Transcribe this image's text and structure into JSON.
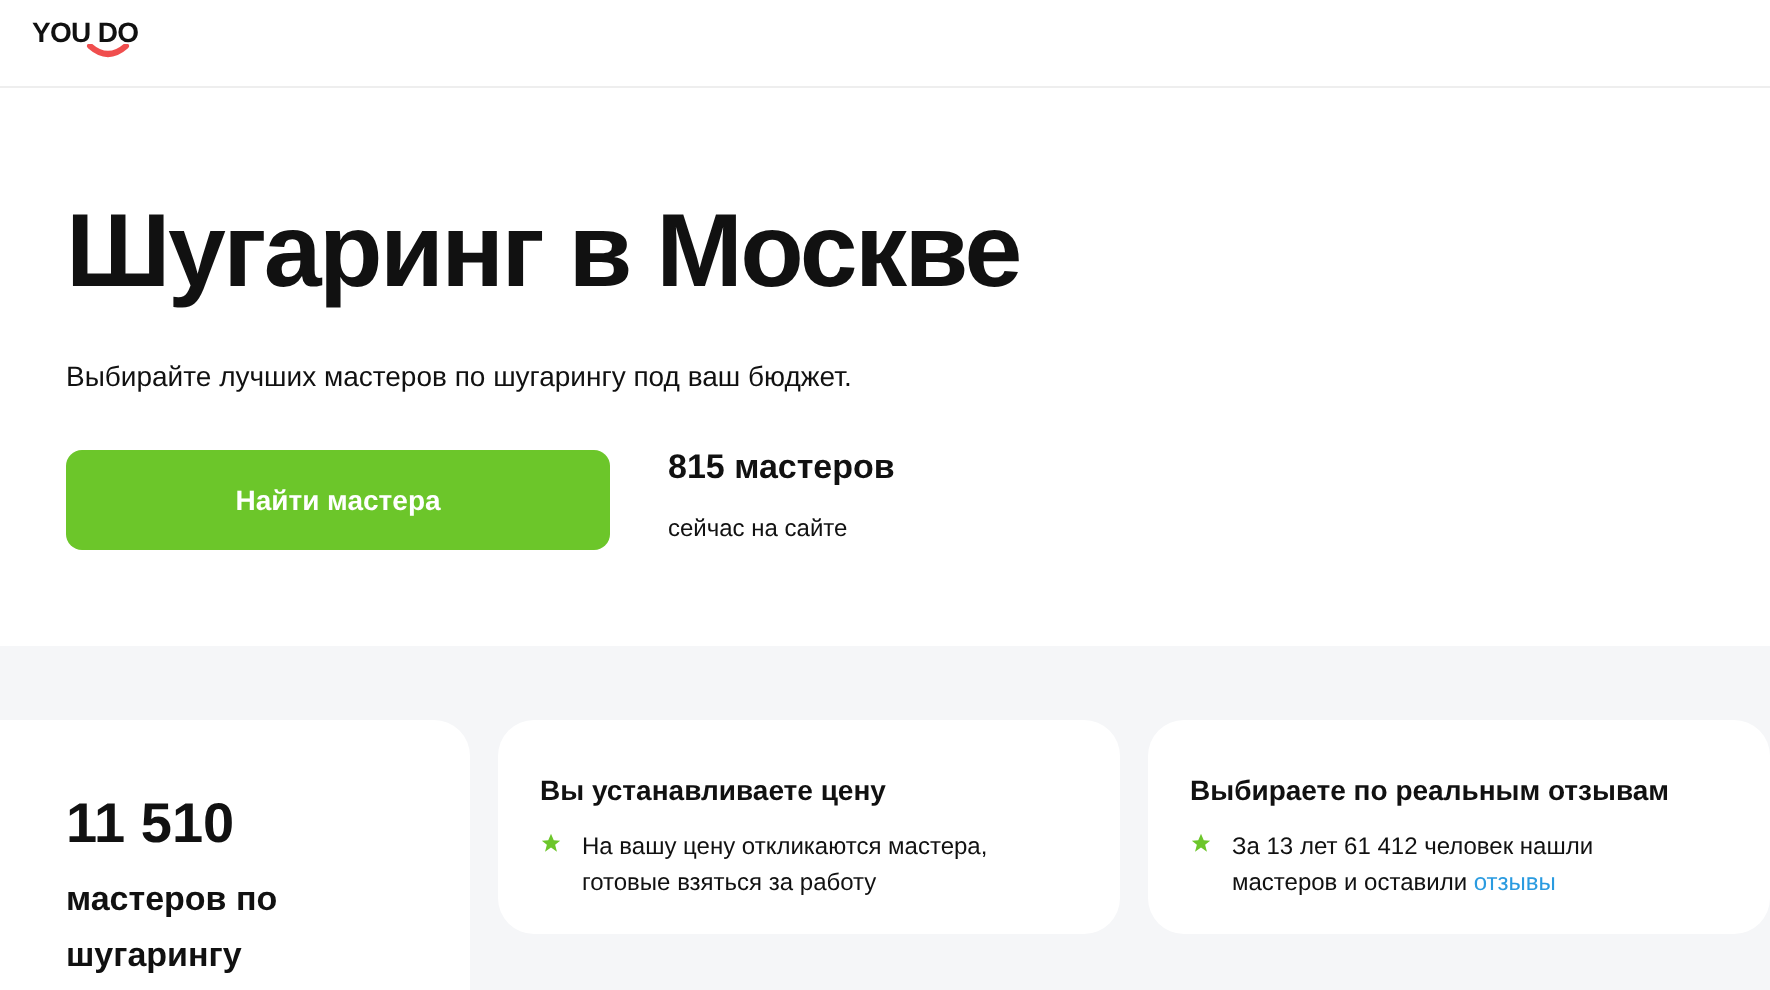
{
  "header": {
    "logo": "YOU DO"
  },
  "hero": {
    "title": "Шугаринг в Москве",
    "subtitle": "Выбирайте лучших мастеров по шугарингу под ваш бюджет.",
    "button": "Найти мастера",
    "count": "815 мастеров",
    "count_caption": "сейчас на сайте"
  },
  "stats": {
    "number": "11 510",
    "caption": "мастеров по шугарингу"
  },
  "features": [
    {
      "title": "Вы устанавливаете цену",
      "text": "На вашу цену откликаются мастера, готовые взяться за работу"
    },
    {
      "title": "Выбираете по реальным отзывам",
      "text": "За 13 лет 61 412 человек нашли мастеров и оставили",
      "link": "отзывы"
    }
  ]
}
